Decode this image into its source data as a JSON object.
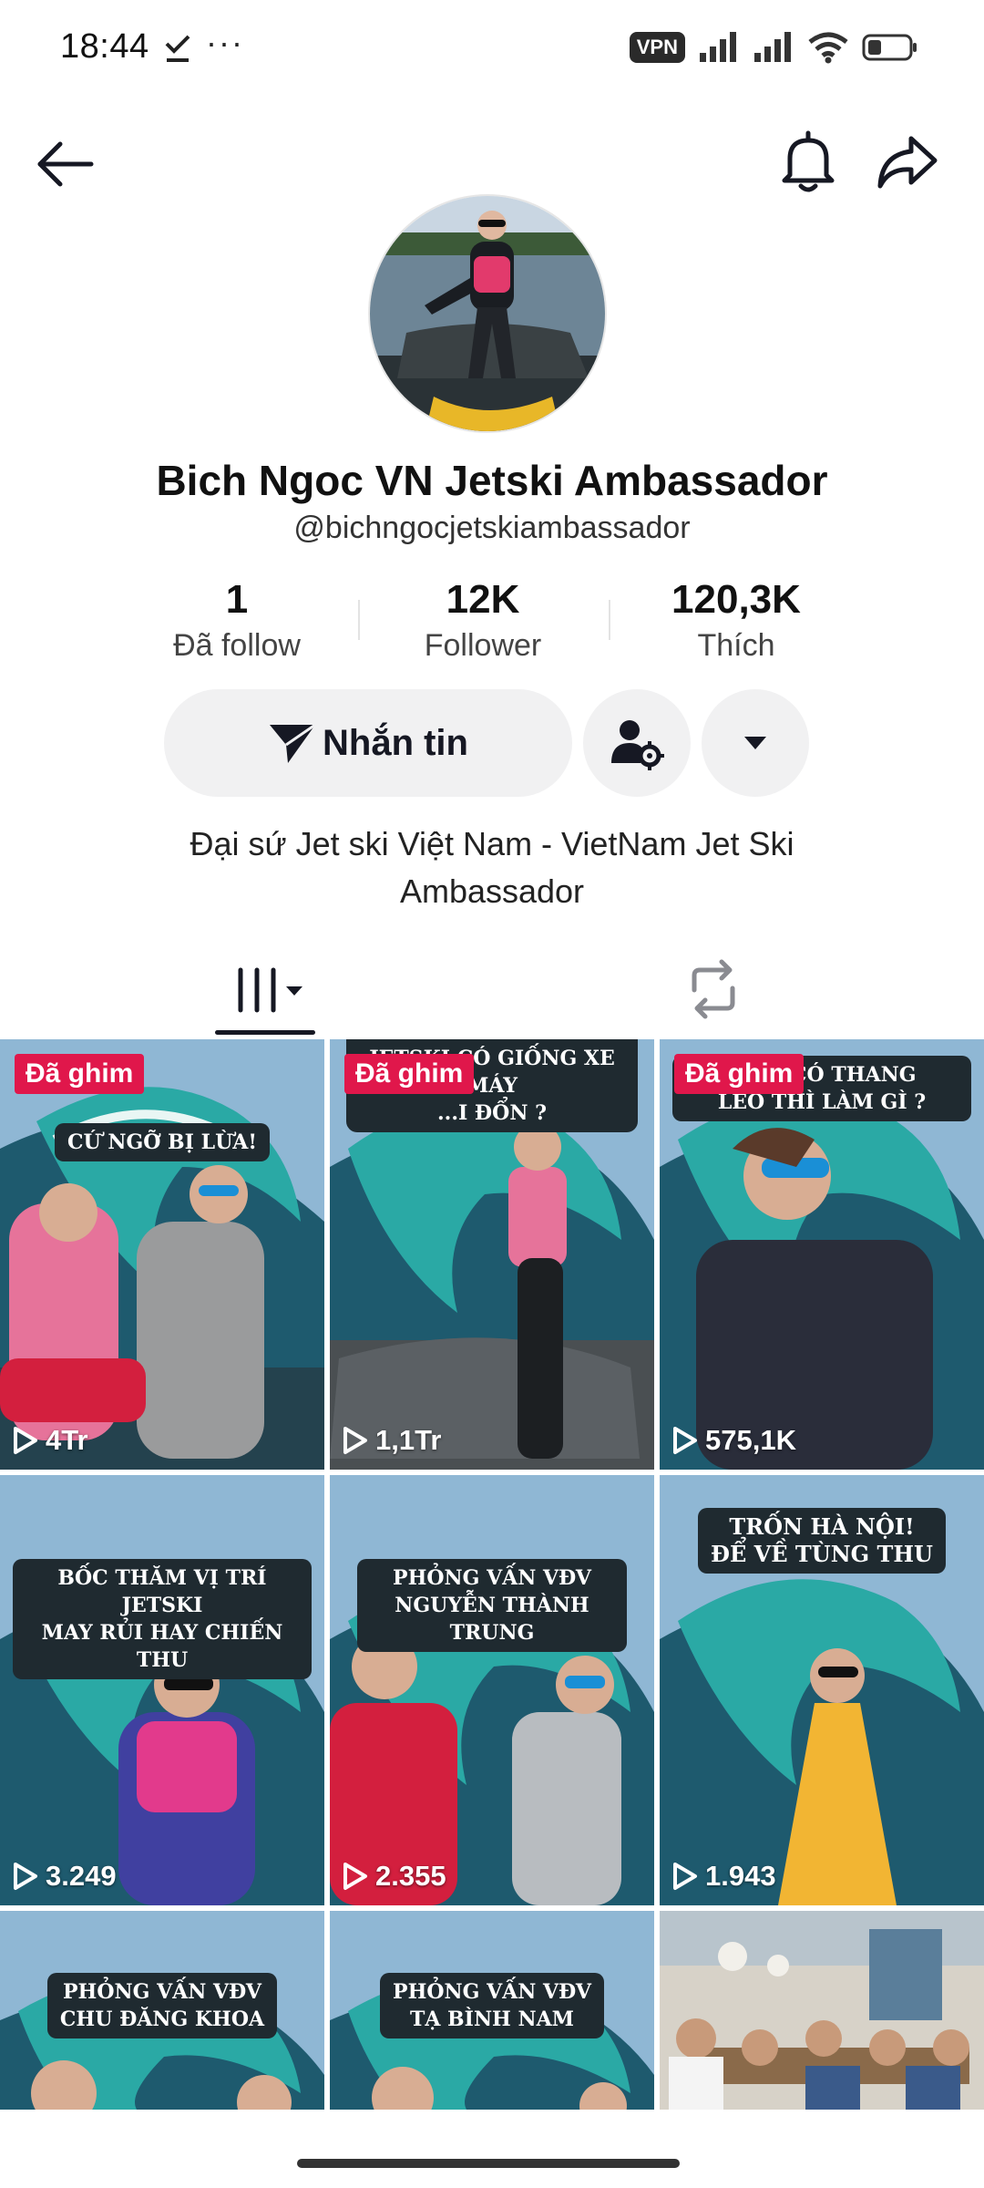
{
  "status_bar": {
    "time": "18:44",
    "dots": "···",
    "vpn": "VPN"
  },
  "profile": {
    "name": "Bich Ngoc VN Jetski Ambassador",
    "handle": "@bichngocjetskiambassador",
    "stats": [
      {
        "value": "1",
        "label": "Đã follow"
      },
      {
        "value": "12K",
        "label": "Follower"
      },
      {
        "value": "120,3K",
        "label": "Thích"
      }
    ],
    "message_button": "Nhắn tin",
    "bio_line1": "Đại sứ Jet ski Việt Nam - VietNam Jet Ski",
    "bio_line2": "Ambassador"
  },
  "colors": {
    "pin_badge": "#e0174b",
    "button_bg": "#f1f1f2",
    "text_primary": "#161823"
  },
  "videos": [
    {
      "pinned": "Đã ghim",
      "caption_1": "CỨ NGỠ BỊ LỪA!",
      "caption_2": "",
      "views": "4Tr"
    },
    {
      "pinned": "Đã ghim",
      "caption_1": "JETSKI CÓ GIỐNG XE MÁY",
      "caption_2": "...I ĐỔN ?",
      "views": "1,1Tr"
    },
    {
      "pinned": "Đã ghim",
      "caption_1": "...NG CÓ THANG",
      "caption_2": "LEO THÌ LÀM GÌ ?",
      "views": "575,1K"
    },
    {
      "pinned": "",
      "caption_1": "BỐC THĂM VỊ TRÍ JETSKI",
      "caption_2": "MAY RỦI HAY CHIẾN THU",
      "views": "3.249"
    },
    {
      "pinned": "",
      "caption_1": "PHỎNG VẤN VĐV",
      "caption_2": "NGUYỄN THÀNH TRUNG",
      "views": "2.355"
    },
    {
      "pinned": "",
      "caption_1": "TRỐN HÀ NỘI!",
      "caption_2": "ĐỂ VỀ TÙNG THU",
      "views": "1.943"
    },
    {
      "pinned": "",
      "caption_1": "PHỎNG VẤN VĐV",
      "caption_2": "CHU ĐĂNG KHOA",
      "views": ""
    },
    {
      "pinned": "",
      "caption_1": "PHỎNG VẤN VĐV",
      "caption_2": "TẠ BÌNH NAM",
      "views": ""
    },
    {
      "pinned": "",
      "caption_1": "",
      "caption_2": "",
      "views": ""
    }
  ]
}
